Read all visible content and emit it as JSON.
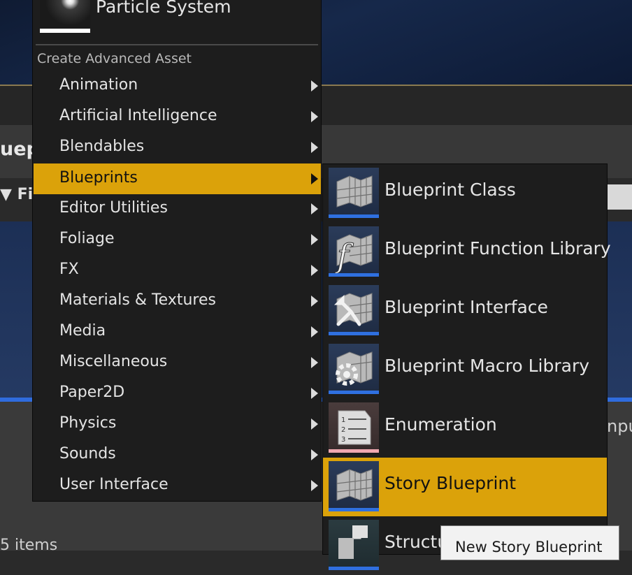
{
  "background": {
    "title_fragment": "uepr",
    "filter_label": "Filt",
    "input_fragment": "npu",
    "items_count": "5 items"
  },
  "menu": {
    "particle_system_label": "Particle System",
    "section_header": "Create Advanced Asset",
    "items": [
      {
        "label": "Animation",
        "selected": false
      },
      {
        "label": "Artificial Intelligence",
        "selected": false
      },
      {
        "label": "Blendables",
        "selected": false
      },
      {
        "label": "Blueprints",
        "selected": true
      },
      {
        "label": "Editor Utilities",
        "selected": false
      },
      {
        "label": "Foliage",
        "selected": false
      },
      {
        "label": "FX",
        "selected": false
      },
      {
        "label": "Materials & Textures",
        "selected": false
      },
      {
        "label": "Media",
        "selected": false
      },
      {
        "label": "Miscellaneous",
        "selected": false
      },
      {
        "label": "Paper2D",
        "selected": false
      },
      {
        "label": "Physics",
        "selected": false
      },
      {
        "label": "Sounds",
        "selected": false
      },
      {
        "label": "User Interface",
        "selected": false
      }
    ]
  },
  "submenu": {
    "items": [
      {
        "label": "Blueprint Class",
        "icon": "blueprint-class-icon"
      },
      {
        "label": "Blueprint Function Library",
        "icon": "blueprint-function-library-icon"
      },
      {
        "label": "Blueprint Interface",
        "icon": "blueprint-interface-icon"
      },
      {
        "label": "Blueprint Macro Library",
        "icon": "blueprint-macro-library-icon"
      },
      {
        "label": "Enumeration",
        "icon": "enumeration-icon"
      },
      {
        "label": "Story Blueprint",
        "icon": "story-blueprint-icon",
        "selected": true
      },
      {
        "label": "Structure",
        "icon": "structure-icon"
      }
    ]
  },
  "tooltip": {
    "text": "New Story Blueprint"
  },
  "colors": {
    "selection_accent": "#dba20a",
    "menu_background": "#1d1d1d",
    "blueprint_underline": "#2f70e0",
    "enumeration_underline": "#f0a8b0"
  }
}
